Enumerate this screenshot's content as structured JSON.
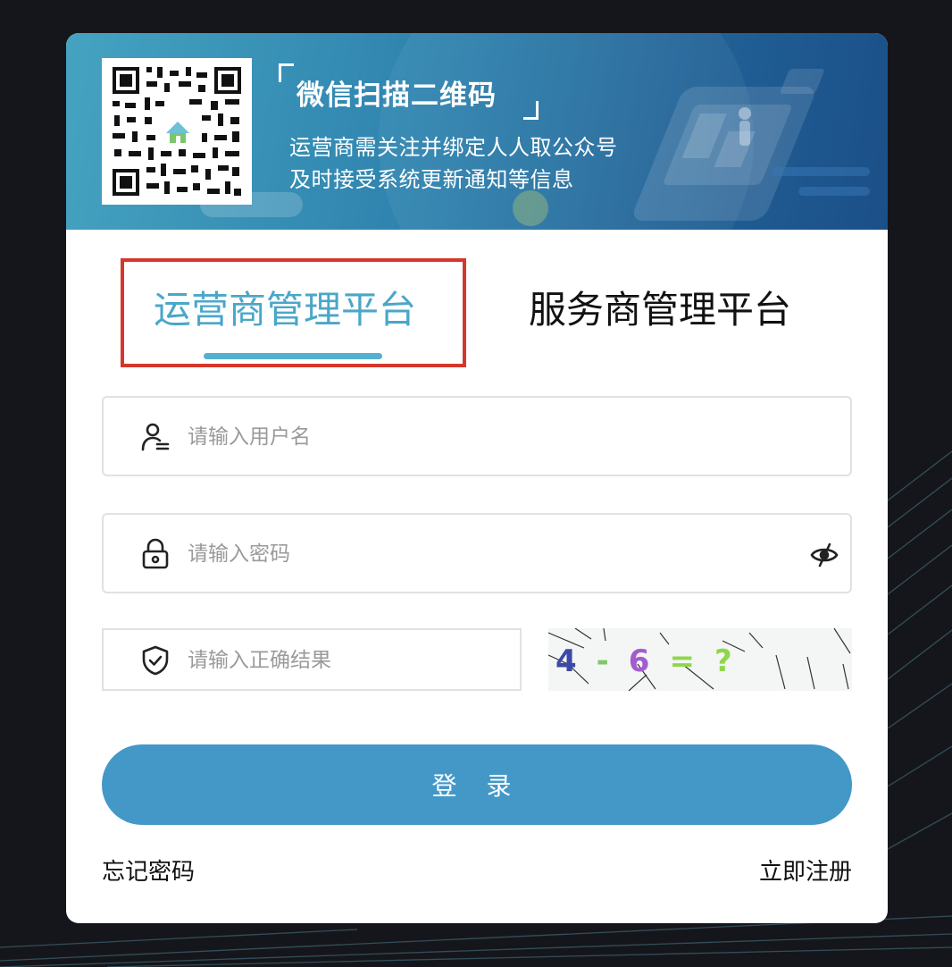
{
  "banner": {
    "title": "微信扫描二维码",
    "line1": "运营商需关注并绑定人人取公众号",
    "line2": "及时接受系统更新通知等信息"
  },
  "tabs": [
    {
      "label": "运营商管理平台",
      "active": true
    },
    {
      "label": "服务商管理平台",
      "active": false
    }
  ],
  "form": {
    "username_placeholder": "请输入用户名",
    "password_placeholder": "请输入密码",
    "captcha_placeholder": "请输入正确结果",
    "captcha_text": "4 - 6 =?",
    "login_label": "登 录"
  },
  "links": {
    "forgot_password": "忘记密码",
    "register": "立即注册"
  },
  "colors": {
    "accent": "#4aa7c8",
    "button": "#4398c8",
    "highlight": "#d6372c",
    "background": "#15161b"
  }
}
